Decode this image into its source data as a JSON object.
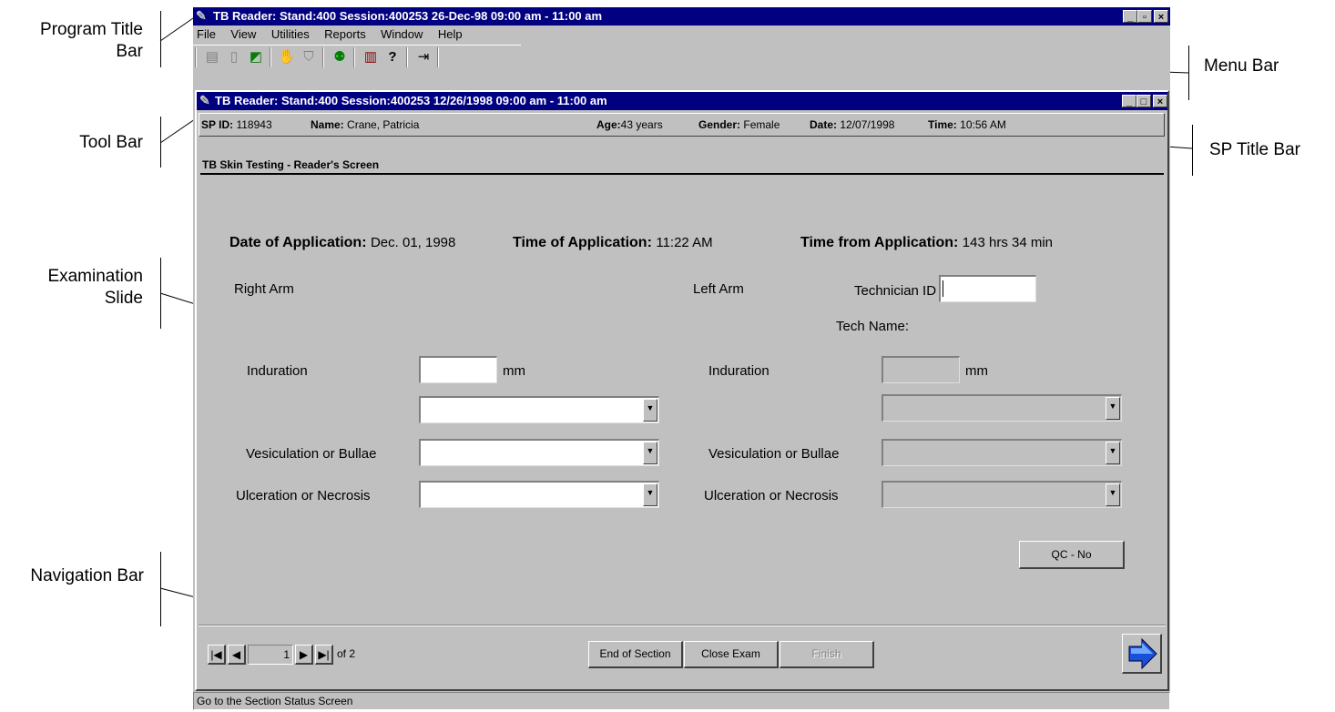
{
  "callouts": {
    "program_title_bar": [
      "Program Title",
      "Bar"
    ],
    "tool_bar": "Tool Bar",
    "examination_slide": [
      "Examination",
      "Slide"
    ],
    "navigation_bar": "Navigation Bar",
    "menu_bar": "Menu Bar",
    "sp_title_bar": "SP Title Bar"
  },
  "program_window": {
    "title": "TB Reader: Stand:400 Session:400253 26-Dec-98 09:00 am - 11:00 am",
    "controls": [
      "_",
      "▫",
      "×"
    ]
  },
  "menu": {
    "items": [
      {
        "label": "File"
      },
      {
        "label": "View"
      },
      {
        "label": "Utilities"
      },
      {
        "label": "Reports"
      },
      {
        "label": "Window"
      },
      {
        "label": "Help"
      }
    ]
  },
  "toolbar": {
    "icons": [
      "new-icon",
      "clipboard-icon",
      "open-icon",
      "stop-hand-icon",
      "filter-icon",
      "users-icon",
      "reports-icon",
      "help-icon",
      "exit-icon"
    ]
  },
  "child_window": {
    "title": "TB Reader: Stand:400 Session:400253 12/26/1998 09:00 am - 11:00 am"
  },
  "sp_bar": {
    "sp_id_label": "SP ID:",
    "sp_id": "118943",
    "name_label": "Name:",
    "name": "Crane, Patricia",
    "age_label": "Age:",
    "age": "43 years",
    "gender_label": "Gender:",
    "gender": "Female",
    "date_label": "Date:",
    "date": "12/07/1998",
    "time_label": "Time:",
    "time": "10:56 AM"
  },
  "section_title": "TB Skin Testing - Reader's Screen",
  "application": {
    "date_label": "Date of Application:",
    "date": "Dec. 01, 1998",
    "time_label": "Time of Application:",
    "time": "11:22 AM",
    "from_label": "Time from Application:",
    "from": "143 hrs 34 min"
  },
  "right_arm": {
    "heading": "Right Arm",
    "induration_label": "Induration",
    "induration_value": "",
    "unit": "mm",
    "vesiculation_label": "Vesiculation or Bullae",
    "ulceration_label": "Ulceration or Necrosis"
  },
  "left_arm": {
    "heading": "Left Arm",
    "induration_label": "Induration",
    "unit": "mm",
    "vesiculation_label": "Vesiculation or Bullae",
    "ulceration_label": "Ulceration or Necrosis"
  },
  "technician": {
    "id_label": "Technician ID",
    "id_value": "",
    "name_label": "Tech Name:"
  },
  "qc_button": "QC - No",
  "navigation": {
    "page": "1",
    "of_text": "of 2",
    "end_section": "End of Section",
    "close_exam": "Close Exam",
    "finish": "Finish"
  },
  "status_bar": "Go to the Section Status Screen"
}
